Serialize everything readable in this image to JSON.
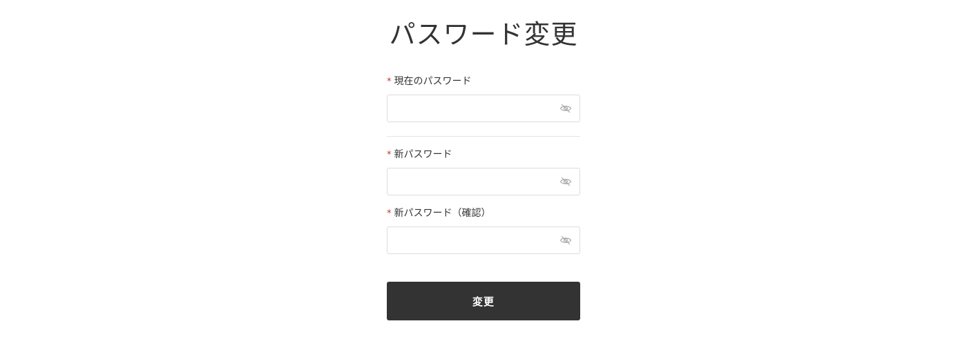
{
  "page": {
    "title": "パスワード変更"
  },
  "form": {
    "required_mark": "*",
    "current_password": {
      "label": "現在のパスワード",
      "value": "",
      "placeholder": "",
      "icon": "eye-slash-icon"
    },
    "new_password": {
      "label": "新パスワード",
      "value": "",
      "placeholder": "",
      "icon": "eye-slash-icon"
    },
    "confirm_password": {
      "label": "新パスワード（確認）",
      "value": "",
      "placeholder": "",
      "icon": "eye-slash-icon"
    },
    "submit_label": "変更"
  },
  "colors": {
    "button_bg": "#333333",
    "required": "#c0392b",
    "border": "#dcdcdc"
  }
}
